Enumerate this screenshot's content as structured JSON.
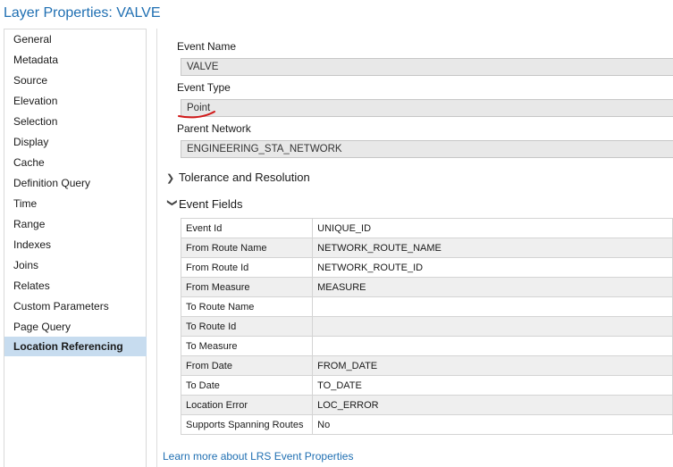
{
  "window": {
    "title": "Layer Properties: VALVE"
  },
  "sidebar": {
    "items": [
      {
        "label": "General"
      },
      {
        "label": "Metadata"
      },
      {
        "label": "Source"
      },
      {
        "label": "Elevation"
      },
      {
        "label": "Selection"
      },
      {
        "label": "Display"
      },
      {
        "label": "Cache"
      },
      {
        "label": "Definition Query"
      },
      {
        "label": "Time"
      },
      {
        "label": "Range"
      },
      {
        "label": "Indexes"
      },
      {
        "label": "Joins"
      },
      {
        "label": "Relates"
      },
      {
        "label": "Custom Parameters"
      },
      {
        "label": "Page Query"
      },
      {
        "label": "Location Referencing",
        "selected": true
      }
    ]
  },
  "form": {
    "event_name": {
      "label": "Event Name",
      "value": "VALVE"
    },
    "event_type": {
      "label": "Event Type",
      "value": "Point"
    },
    "parent_network": {
      "label": "Parent Network",
      "value": "ENGINEERING_STA_NETWORK"
    }
  },
  "sections": {
    "tolerance": {
      "label": "Tolerance and Resolution",
      "expanded": false
    },
    "event_fields": {
      "label": "Event Fields",
      "expanded": true
    }
  },
  "event_fields": [
    {
      "name": "Event Id",
      "value": "UNIQUE_ID"
    },
    {
      "name": "From Route Name",
      "value": "NETWORK_ROUTE_NAME"
    },
    {
      "name": "From Route Id",
      "value": "NETWORK_ROUTE_ID"
    },
    {
      "name": "From Measure",
      "value": "MEASURE"
    },
    {
      "name": "To Route Name",
      "value": ""
    },
    {
      "name": "To Route Id",
      "value": ""
    },
    {
      "name": "To Measure",
      "value": ""
    },
    {
      "name": "From Date",
      "value": "FROM_DATE"
    },
    {
      "name": "To Date",
      "value": "TO_DATE"
    },
    {
      "name": "Location Error",
      "value": "LOC_ERROR"
    },
    {
      "name": "Supports Spanning Routes",
      "value": "No"
    }
  ],
  "footer": {
    "link_label": "Learn more about LRS Event Properties"
  },
  "colors": {
    "accent": "#1f6fb2",
    "selected_bg": "#c7dcef",
    "annotation": "#d11a1a"
  }
}
